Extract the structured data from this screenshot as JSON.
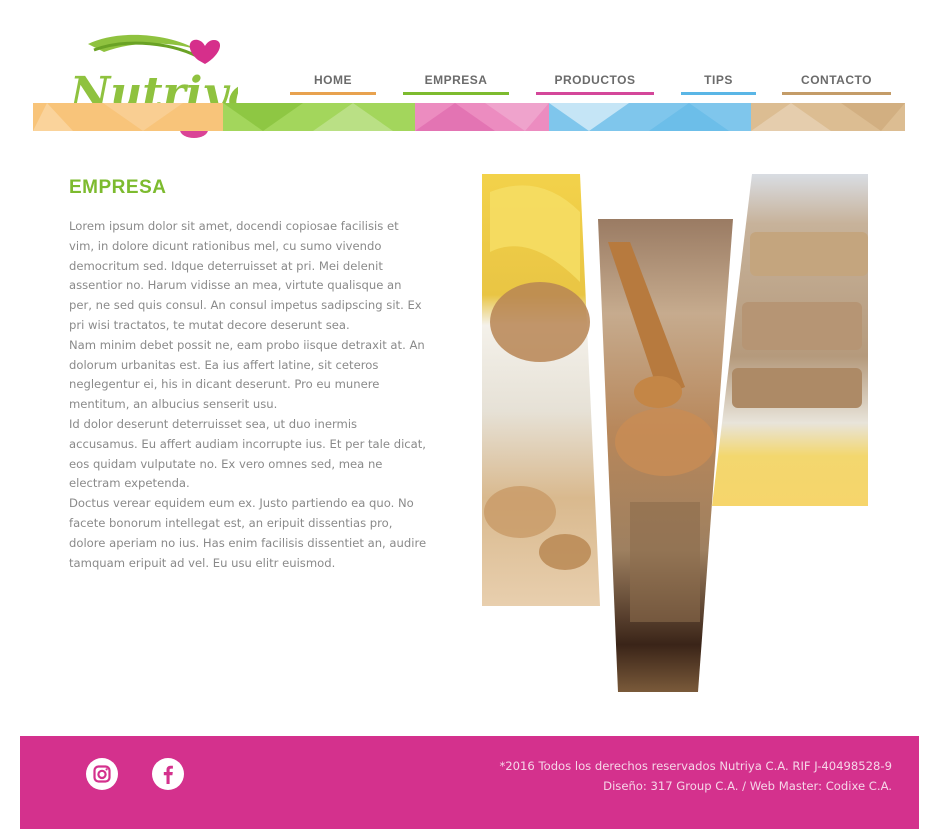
{
  "brand": {
    "name": "Nutriya",
    "logo_text": "Nutriya"
  },
  "nav": {
    "items": [
      {
        "label": "HOME",
        "color": "#e8a24f"
      },
      {
        "label": "EMPRESA",
        "color": "#7dbb2f"
      },
      {
        "label": "PRODUCTOS",
        "color": "#d4479a"
      },
      {
        "label": "TIPS",
        "color": "#5ab6e6"
      },
      {
        "label": "CONTACTO",
        "color": "#c49c68"
      }
    ]
  },
  "strip_colors": [
    "#f8c47a",
    "#a3d65c",
    "#ec8cc0",
    "#7fc6ec",
    "#dcbd92"
  ],
  "page": {
    "title": "EMPRESA",
    "title_color": "#7dbb2f",
    "paragraphs": [
      "Lorem ipsum dolor sit amet, docendi copiosae facilisis et vim, in dolore dicunt rationibus mel, cu sumo vivendo democritum sed. Idque deterruisset at pri. Mei delenit assentior no. Harum vidisse an mea, virtute qualisque an per, ne sed quis consul. An consul impetus sadipscing sit. Ex pri wisi tractatos, te mutat decore deserunt sea.",
      "Nam minim debet possit ne, eam probo iisque detraxit at. An dolorum urbanitas est. Ea ius affert latine, sit ceteros neglegentur ei, his in dicant deserunt. Pro eu munere mentitum, an albucius senserit usu.",
      "Id dolor deserunt deterruisset sea, ut duo inermis accusamus. Eu affert audiam incorrupte ius. Et per tale dicat, eos quidam vulputate no. Ex vero omnes sed, mea ne electram expetenda.",
      "Doctus verear equidem eum ex. Justo partiendo ea quo. No facete bonorum intellegat est, an eripuit dissentias pro, dolore aperiam no ius. Has enim facilisis dissentiet an, audire tamquam eripuit ad vel. Eu usu elitr euismod."
    ]
  },
  "footer": {
    "bg_color": "#d4318d",
    "copyright": "*2016 Todos los derechos reservados Nutriya C.A. RIF J-40498528-9",
    "credits": "Diseño: 317 Group C.A. / Web Master: Codixe C.A.",
    "social": [
      {
        "icon": "instagram-icon"
      },
      {
        "icon": "facebook-icon"
      }
    ]
  }
}
